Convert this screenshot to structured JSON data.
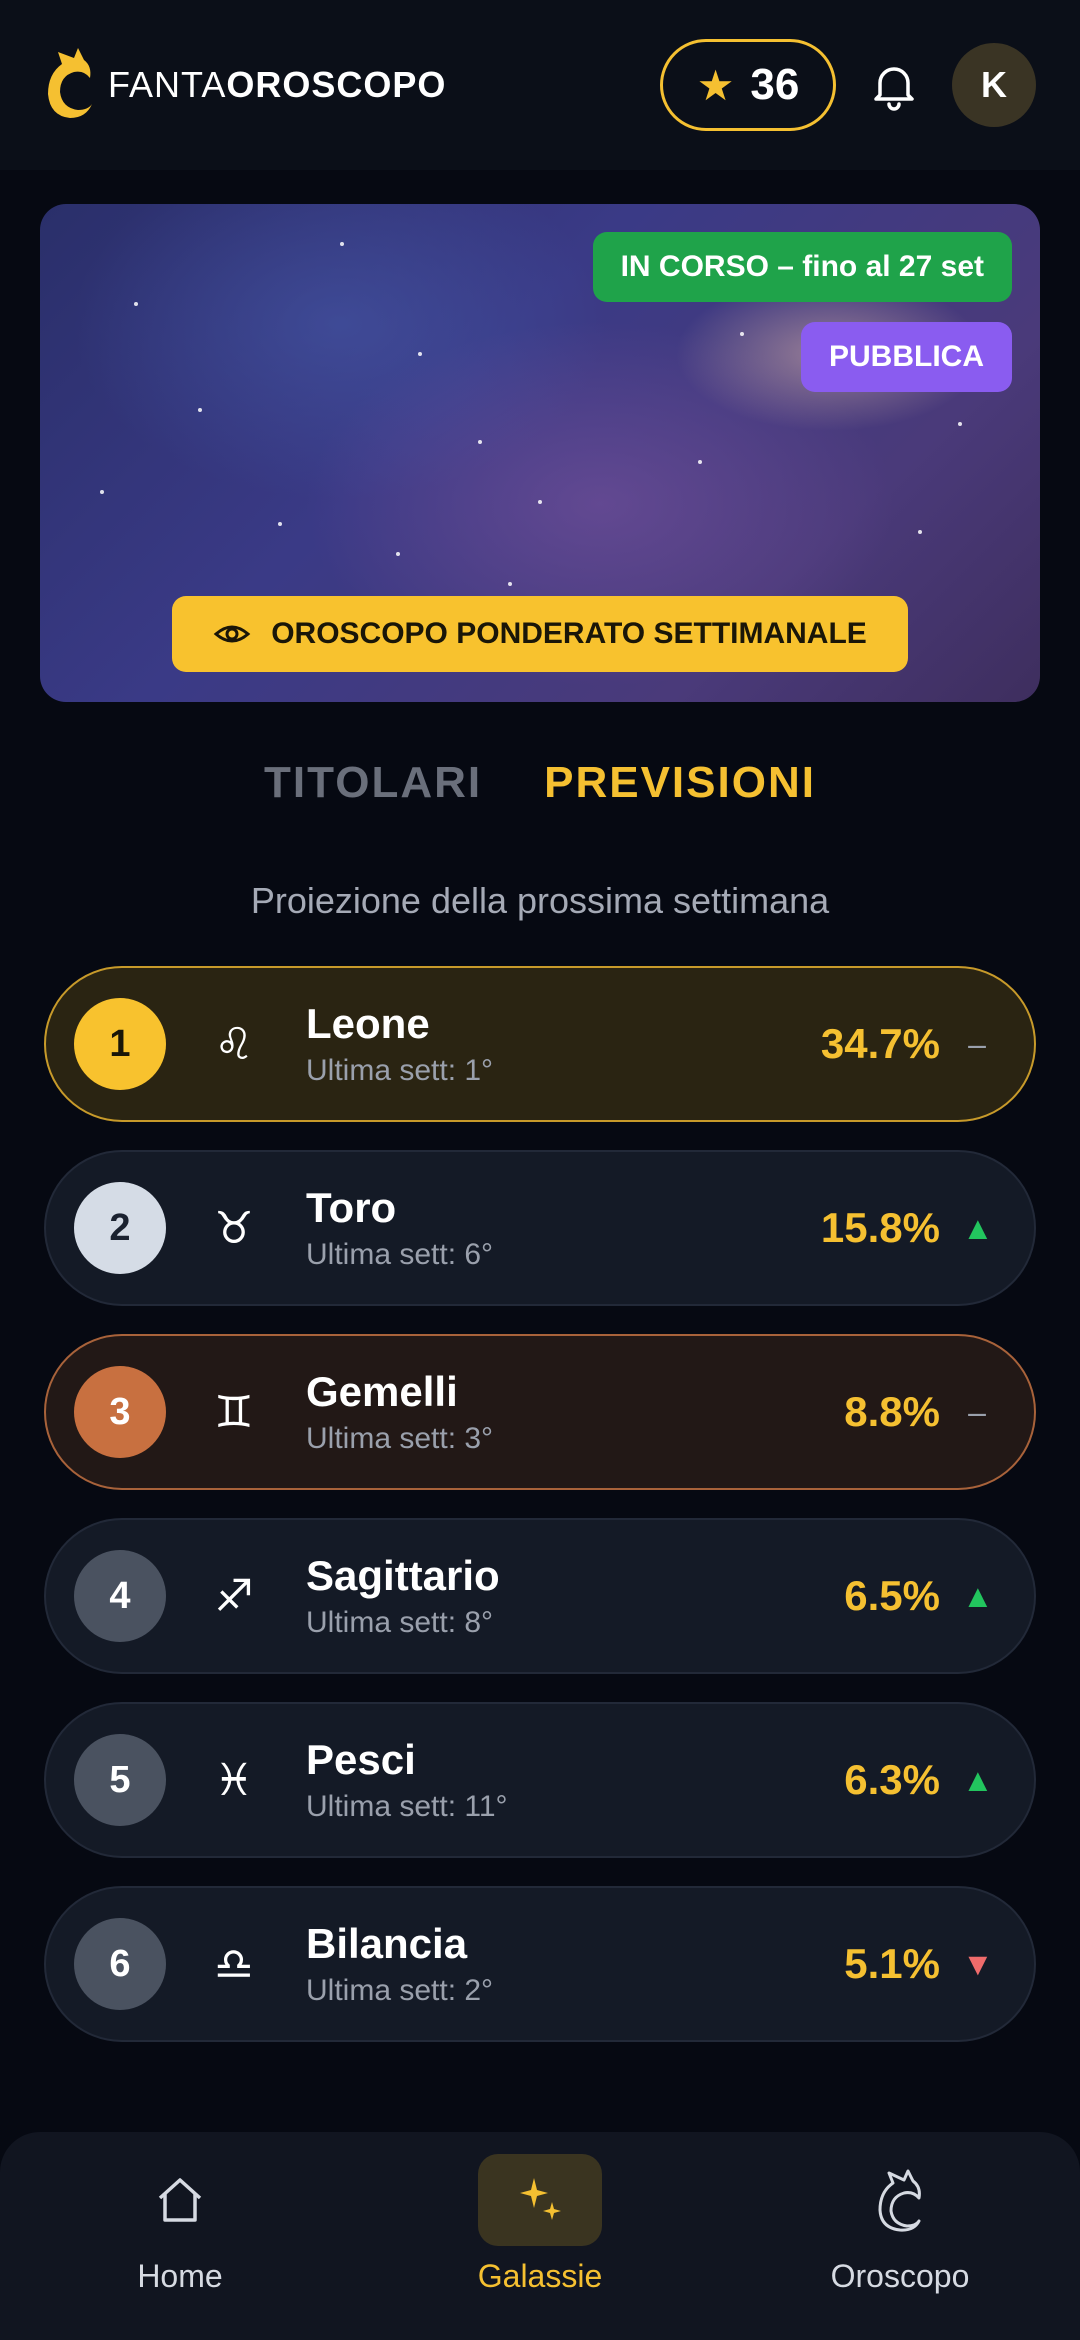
{
  "header": {
    "logo_light": "FANTA",
    "logo_bold": "OROSCOPO",
    "points": "36",
    "avatar_initial": "K"
  },
  "banner": {
    "status": "IN CORSO – fino al 27 set",
    "visibility": "PUBBLICA",
    "cta_label": "OROSCOPO PONDERATO SETTIMANALE"
  },
  "tabs": [
    {
      "label": "TITOLARI",
      "active": false
    },
    {
      "label": "PREVISIONI",
      "active": true
    }
  ],
  "subtitle": "Proiezione della prossima settimana",
  "rankings": [
    {
      "rank": "1",
      "symbol": "♌",
      "name": "Leone",
      "last_week": "Ultima sett: 1°",
      "percent": "34.7%",
      "trend": "–"
    },
    {
      "rank": "2",
      "symbol": "♉",
      "name": "Toro",
      "last_week": "Ultima sett: 6°",
      "percent": "15.8%",
      "trend": "▲"
    },
    {
      "rank": "3",
      "symbol": "♊",
      "name": "Gemelli",
      "last_week": "Ultima sett: 3°",
      "percent": "8.8%",
      "trend": "–"
    },
    {
      "rank": "4",
      "symbol": "♐",
      "name": "Sagittario",
      "last_week": "Ultima sett: 8°",
      "percent": "6.5%",
      "trend": "▲"
    },
    {
      "rank": "5",
      "symbol": "♓",
      "name": "Pesci",
      "last_week": "Ultima sett: 11°",
      "percent": "6.3%",
      "trend": "▲"
    },
    {
      "rank": "6",
      "symbol": "♎",
      "name": "Bilancia",
      "last_week": "Ultima sett: 2°",
      "percent": "5.1%",
      "trend": "▼"
    }
  ],
  "nav": [
    {
      "label": "Home",
      "icon": "home-icon",
      "active": false
    },
    {
      "label": "Galassie",
      "icon": "sparkles-icon",
      "active": true
    },
    {
      "label": "Oroscopo",
      "icon": "moon-cat-icon",
      "active": false
    }
  ],
  "colors": {
    "accent": "#f5c031",
    "live": "#1fa34a",
    "public": "#8a5cf0",
    "trend_up": "#22c55e",
    "trend_down": "#ef6b6b"
  }
}
